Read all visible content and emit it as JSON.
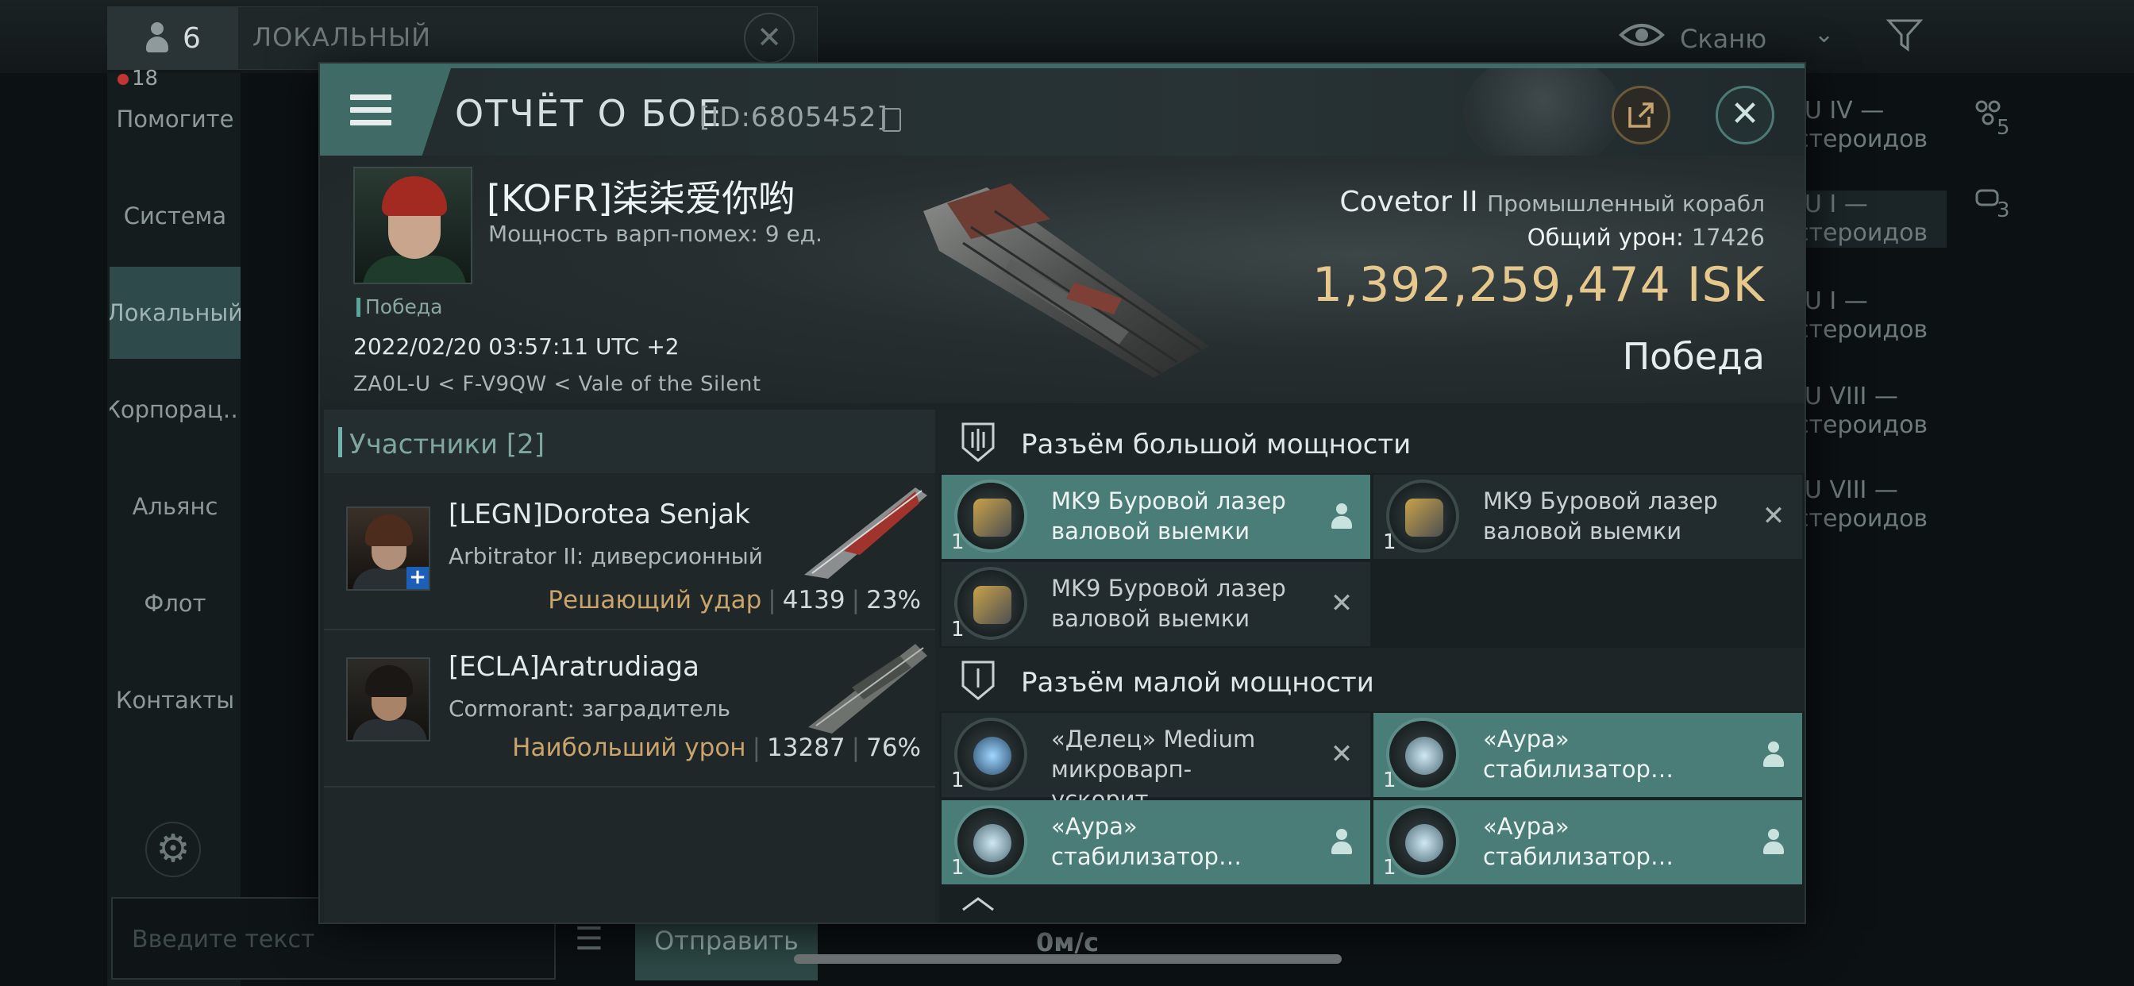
{
  "background": {
    "member_count": "6",
    "chat_title": "ЛОКАЛЬНЫЙ",
    "unread_badge": "18",
    "sidebar": [
      {
        "label": "Помогите",
        "active": false
      },
      {
        "label": "Система",
        "active": false
      },
      {
        "label": "Локальный",
        "active": true
      },
      {
        "label": "Корпорац…",
        "active": false
      },
      {
        "label": "Альянс",
        "active": false
      },
      {
        "label": "Флот",
        "active": false
      },
      {
        "label": "Контакты",
        "active": false
      }
    ],
    "scan_label": "Сканю",
    "input_placeholder": "Введите текст",
    "send_label": "Отправить",
    "speed": "0м/с",
    "right_list": [
      {
        "line1": "-U IV —",
        "line2": "стероидов"
      },
      {
        "line1": "-U I —",
        "line2": "стероидов"
      },
      {
        "line1": "-U I —",
        "line2": "стероидов"
      },
      {
        "line1": "-U VIII —",
        "line2": "стероидов"
      },
      {
        "line1": "-U VIII —",
        "line2": "стероидов"
      }
    ],
    "right_counts": [
      "5",
      "3"
    ]
  },
  "dialog": {
    "title": "ОТЧЁТ О БОЕ",
    "report_id": "[ID:6805452]",
    "victim": {
      "name": "[KOFR]柒柒爱你哟",
      "warp_disruption": "Мощность варп-помех: 9 ед.",
      "tag": "Победа",
      "timestamp": "2022/02/20 03:57:11 UTC +2",
      "location": "ZA0L-U < F-V9QW < Vale of the Silent",
      "ship": "Covetor II",
      "ship_class": "Промышленный корабл",
      "total_damage_label": "Общий урон:",
      "total_damage": "17426",
      "isk_value": "1,392,259,474",
      "isk_currency": "ISK",
      "result": "Победа"
    },
    "participants": {
      "heading": "Участники [2]",
      "items": [
        {
          "name": "[LEGN]Dorotea Senjak",
          "ship": "Arbitrator II: диверсионный",
          "stat_label": "Решающий удар",
          "damage": "4139",
          "percent": "23%"
        },
        {
          "name": "[ECLA]Aratrudiaga",
          "ship": "Cormorant: заградитель",
          "stat_label": "Наибольший урон",
          "damage": "13287",
          "percent": "76%"
        }
      ]
    },
    "slots": {
      "high_label": "Разъём большой мощности",
      "low_label": "Разъём малой мощности",
      "high": [
        {
          "line1": "MK9 Буровой лазер",
          "line2": "валовой выемки",
          "qty": "1",
          "state": "on"
        },
        {
          "line1": "MK9 Буровой лазер",
          "line2": "валовой выемки",
          "qty": "1",
          "state": "off"
        },
        {
          "line1": "MK9 Буровой лазер",
          "line2": "валовой выемки",
          "qty": "1",
          "state": "off"
        }
      ],
      "low": [
        {
          "line1": "«Делец» Medium",
          "line2": "микроварп-ускорит….",
          "qty": "1",
          "state": "off"
        },
        {
          "line1": "«Аура»",
          "line2": "стабилизатор…",
          "qty": "1",
          "state": "on"
        },
        {
          "line1": "«Аура»",
          "line2": "стабилизатор…",
          "qty": "1",
          "state": "on"
        },
        {
          "line1": "«Аура»",
          "line2": "стабилизатор…",
          "qty": "1",
          "state": "on"
        }
      ]
    }
  }
}
